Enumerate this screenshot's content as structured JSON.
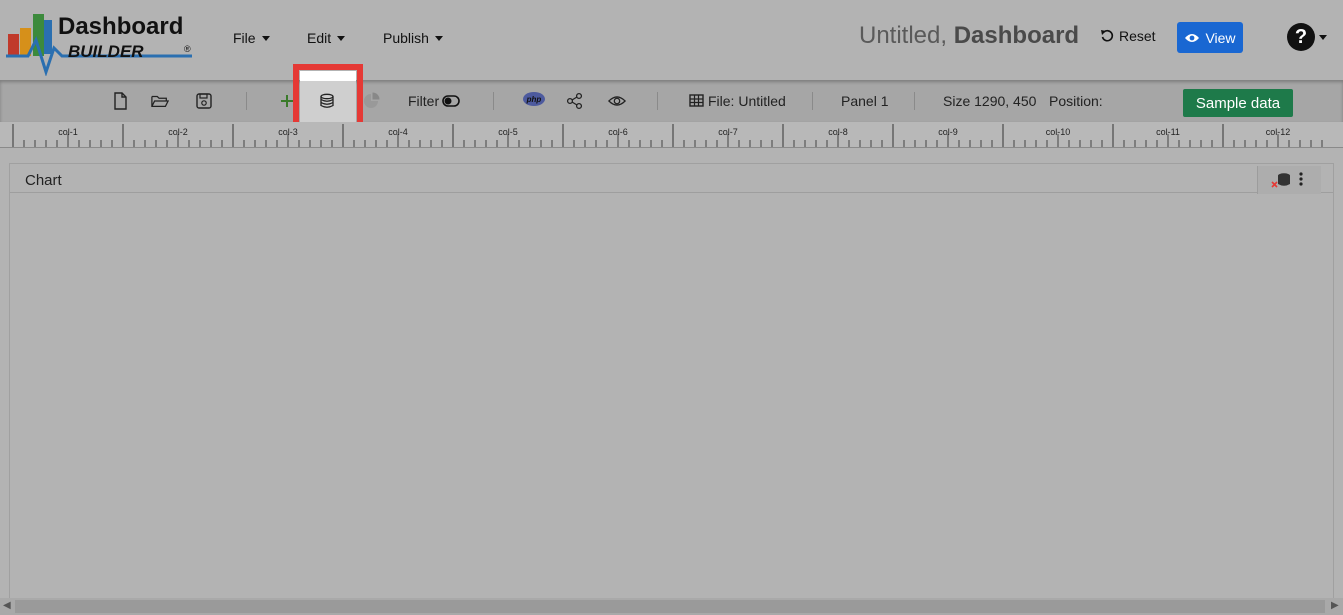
{
  "app": {
    "logo_word1": "Dashboard",
    "logo_word2": "BUILDER",
    "logo_mark": "®"
  },
  "menu": [
    {
      "label": "File"
    },
    {
      "label": "Edit"
    },
    {
      "label": "Publish"
    }
  ],
  "doc": {
    "title_prefix": "Untitled,",
    "title_bold": "Dashboard"
  },
  "header_actions": {
    "reset_label": "Reset",
    "view_label": "View",
    "help_label": "?"
  },
  "toolbar": {
    "filter_label": "Filter",
    "php_label": "php",
    "file_label": "File: Untitled",
    "panel_label": "Panel 1",
    "size_label": "Size 1290, 450",
    "position_label": "Position:",
    "sample_data_label": "Sample data",
    "icons": [
      "new-file-icon",
      "open-folder-icon",
      "save-icon",
      "add-panel-icon",
      "database-icon",
      "pie-chart-icon",
      "filter-toggle-icon",
      "php-icon",
      "share-icon",
      "preview-eye-icon",
      "table-icon"
    ]
  },
  "ruler": {
    "labels": [
      "col-1",
      "col-2",
      "col-3",
      "col-4",
      "col-5",
      "col-6",
      "col-7",
      "col-8",
      "col-9",
      "col-10",
      "col-11",
      "col-12"
    ]
  },
  "panel": {
    "title": "Chart"
  },
  "colors": {
    "view_button": "#1967d2",
    "sample_button": "#1e7a4a",
    "highlight": "#e53935",
    "background": "#b3b3b3"
  }
}
